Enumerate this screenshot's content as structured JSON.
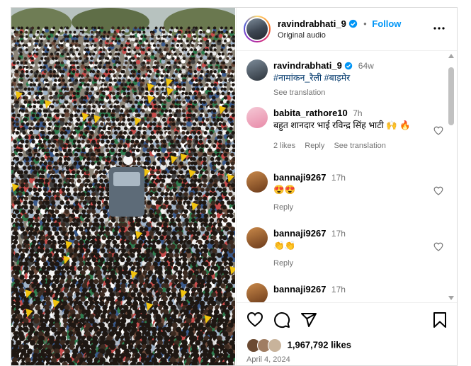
{
  "post": {
    "username": "ravindrabhati_9",
    "follow_label": "Follow",
    "audio": "Original audio"
  },
  "comments": [
    {
      "username": "ravindrabhati_9",
      "time": "64w",
      "text": "#नामांकन_रैली #बाड़मेर",
      "translation": "See translation"
    },
    {
      "username": "babita_rathore10",
      "time": "7h",
      "text": "बहुत शानदार भाई रविन्द्र सिंह भाटी 🙌 🔥",
      "likes": "2 likes",
      "reply": "Reply",
      "translation": "See translation"
    },
    {
      "username": "bannaji9267",
      "time": "17h",
      "text": "😍😍",
      "reply": "Reply"
    },
    {
      "username": "bannaji9267",
      "time": "17h",
      "text": "👏👏",
      "reply": "Reply"
    },
    {
      "username": "bannaji9267",
      "time": "17h",
      "text": ""
    }
  ],
  "engagement": {
    "likes": "1,967,792 likes",
    "date": "April 4, 2024"
  },
  "colors": {
    "link_blue": "#0095f6",
    "verified_blue": "#0095f6",
    "muted_text": "#737373"
  },
  "icons": [
    "heart-icon",
    "comment-icon",
    "share-icon",
    "bookmark-icon",
    "more-options-icon",
    "verified-icon"
  ]
}
